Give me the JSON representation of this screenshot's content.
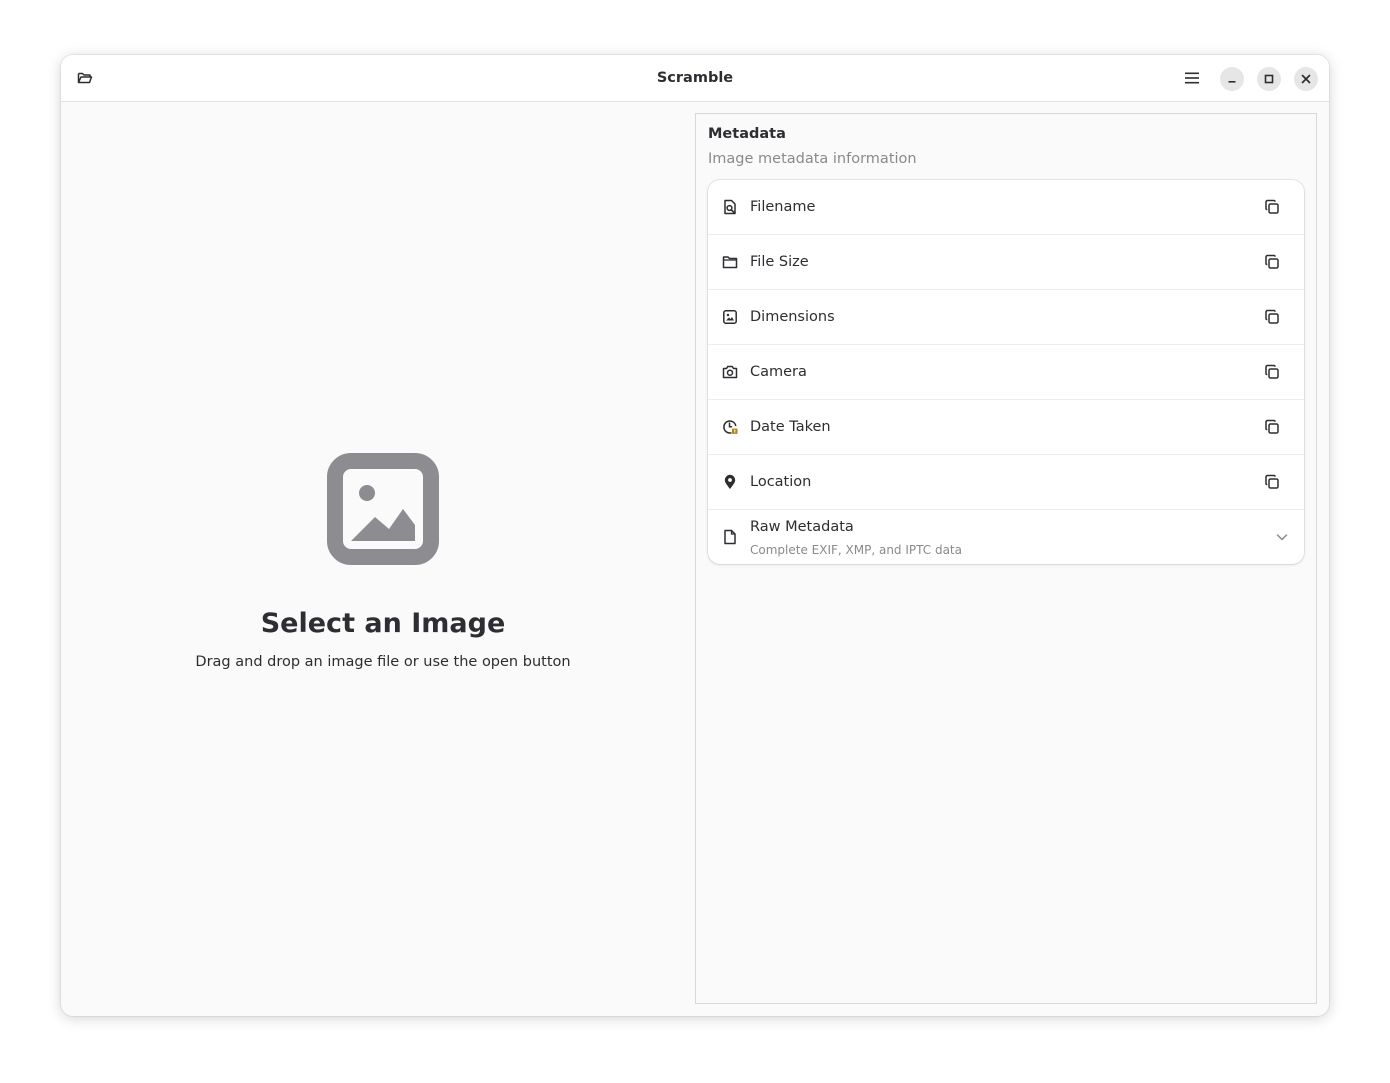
{
  "window": {
    "title": "Scramble"
  },
  "headerbar": {
    "open_icon": "folder-open-icon",
    "menu_icon": "hamburger-menu-icon",
    "minimize_icon": "minimize-icon",
    "maximize_icon": "maximize-icon",
    "close_icon": "close-icon"
  },
  "status_page": {
    "icon": "image-placeholder-icon",
    "title": "Select an Image",
    "description": "Drag and drop an image file or use the open button"
  },
  "metadata": {
    "heading": "Metadata",
    "subheading": "Image metadata information",
    "rows": [
      {
        "label": "Filename",
        "icon": "file-search-icon"
      },
      {
        "label": "File Size",
        "icon": "folder-icon"
      },
      {
        "label": "Dimensions",
        "icon": "image-icon"
      },
      {
        "label": "Camera",
        "icon": "camera-icon"
      },
      {
        "label": "Date Taken",
        "icon": "clock-icon"
      },
      {
        "label": "Location",
        "icon": "map-pin-icon"
      }
    ],
    "raw": {
      "label": "Raw Metadata",
      "subtitle": "Complete EXIF, XMP, and IPTC data",
      "icon": "document-icon"
    }
  },
  "colors": {
    "window_bg": "#fafafa",
    "icon_gray": "#8d8d91",
    "text": "#2e2e32",
    "dim_text": "#8a8a8e"
  }
}
